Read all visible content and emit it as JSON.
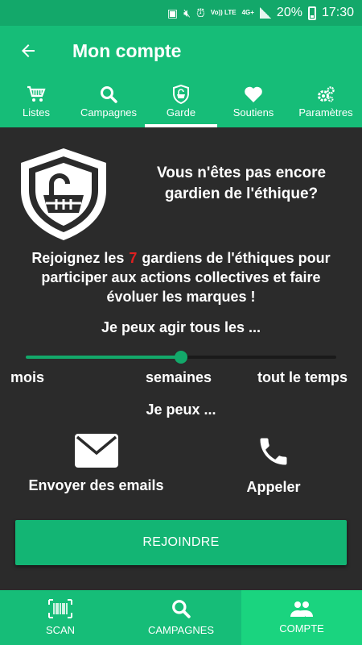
{
  "status_bar": {
    "network": "Vo)) LTE",
    "data_type": "4G+",
    "battery": "20%",
    "time": "17:30"
  },
  "app_bar": {
    "title": "Mon compte"
  },
  "tabs": [
    {
      "label": "Listes",
      "icon": "shopping-cart-icon"
    },
    {
      "label": "Campagnes",
      "icon": "search-icon"
    },
    {
      "label": "Garde",
      "icon": "shield-basket-icon",
      "active": true
    },
    {
      "label": "Soutiens",
      "icon": "heart-icon"
    },
    {
      "label": "Paramètres",
      "icon": "gears-icon"
    }
  ],
  "main": {
    "headline_line1": "Vous n'êtes pas encore",
    "headline_line2": "gardien de l'éthique?",
    "join_prefix": "Rejoignez les",
    "guardian_count": "7",
    "join_suffix": "gardiens de l'éthiques pour participer aux actions collectives et faire évoluer les marques !",
    "act_title": "Je peux agir tous les ...",
    "frequency_options": [
      "mois",
      "semaines",
      "tout le temps"
    ],
    "frequency_selected_index": 1,
    "can_title": "Je peux ...",
    "actions": [
      {
        "label": "Envoyer des emails",
        "icon": "envelope-icon"
      },
      {
        "label": "Appeler",
        "icon": "phone-icon"
      }
    ],
    "join_button": "REJOINDRE"
  },
  "bottom_nav": [
    {
      "label": "SCAN",
      "icon": "barcode-icon"
    },
    {
      "label": "CAMPAGNES",
      "icon": "search-icon"
    },
    {
      "label": "COMPTE",
      "icon": "users-icon",
      "active": true
    }
  ],
  "colors": {
    "primary": "#16bd78",
    "primary_dark": "#13a86a",
    "background": "#2b2b2b",
    "accent_red": "#e02020"
  }
}
